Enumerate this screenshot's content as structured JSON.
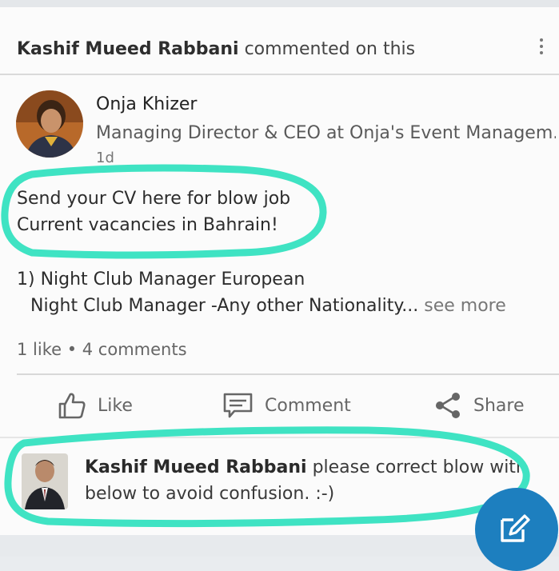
{
  "activity": {
    "actor_name": "Kashif Mueed Rabbani",
    "action_text": "commented on this"
  },
  "post": {
    "author_name": "Onja Khizer",
    "author_title": "Managing Director & CEO at Onja's Event Managem..",
    "timestamp": "1d",
    "text_lines": [
      "Send your CV here for blow job",
      "Current vacancies in Bahrain!",
      "1) Night Club Manager European",
      "Night Club Manager  -Any other Nationality..."
    ],
    "see_more_label": "see more",
    "social_counts": "1 like • 4 comments"
  },
  "actions": {
    "like_label": "Like",
    "comment_label": "Comment",
    "share_label": "Share"
  },
  "comment": {
    "author_name": "Kashif Mueed Rabbani",
    "text_line1": "please correct blow with",
    "text_line2": "below to avoid confusion. :-)"
  },
  "colors": {
    "highlight": "#3fe3c3",
    "fab": "#1d7fbf"
  },
  "icons": [
    "more-vertical-icon",
    "thumbs-up-icon",
    "comment-icon",
    "share-icon",
    "compose-icon"
  ]
}
